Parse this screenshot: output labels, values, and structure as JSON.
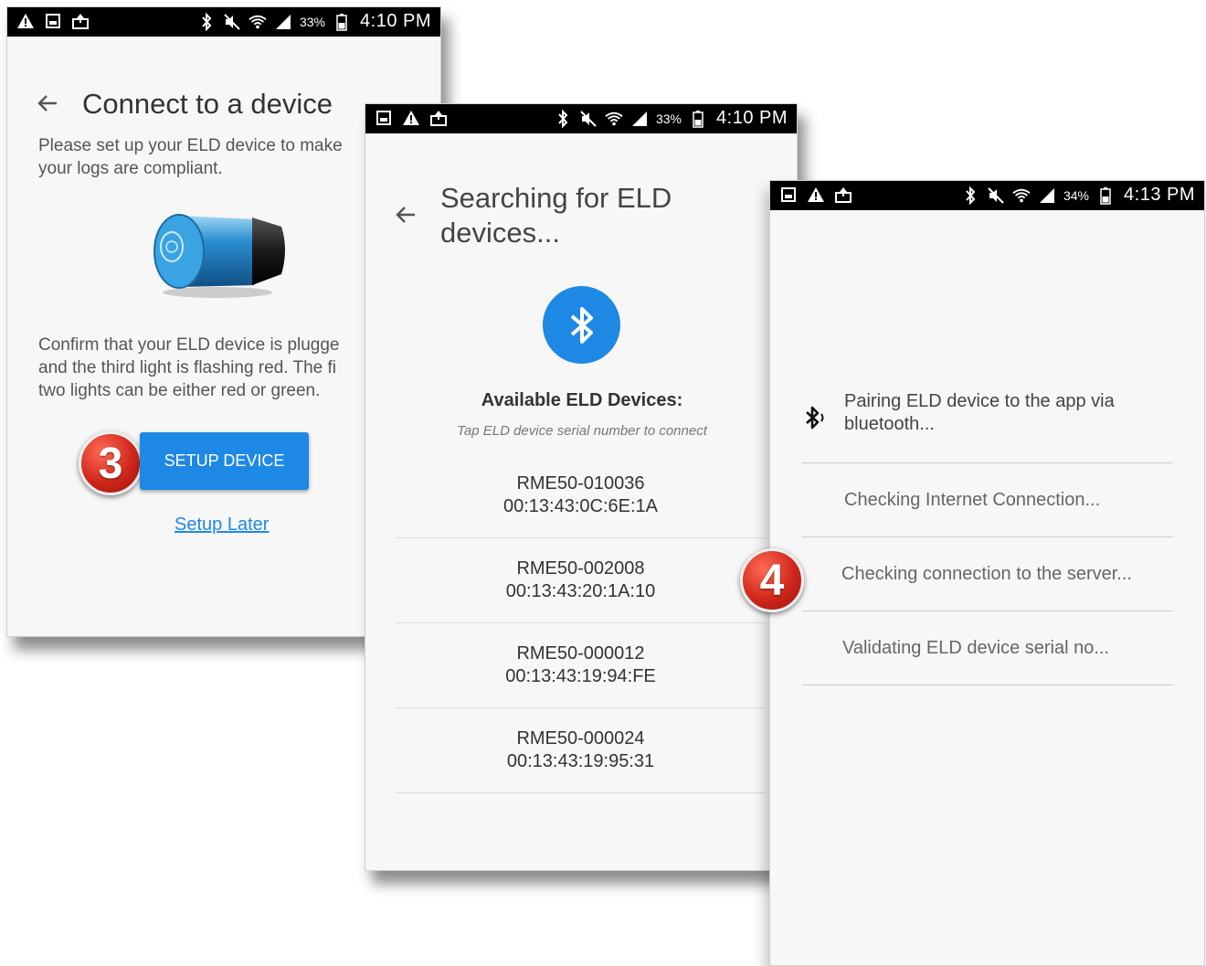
{
  "screen1": {
    "status": {
      "battery": "33%",
      "time": "4:10 PM"
    },
    "title": "Connect to a device",
    "intro": "Please set up your ELD device to make\nyour logs are compliant.",
    "confirm": "Confirm that your ELD device is plugge\nand the third light is flashing red. The fi\ntwo lights can be either red or green.",
    "badge": "3",
    "setup_button": "SETUP DEVICE",
    "setup_later": "Setup Later"
  },
  "screen2": {
    "status": {
      "battery": "33%",
      "time": "4:10 PM"
    },
    "title": "Searching for ELD\ndevices...",
    "available_title": "Available ELD Devices:",
    "available_subtitle": "Tap ELD device serial number to connect",
    "devices": [
      {
        "serial": "RME50-010036",
        "mac": "00:13:43:0C:6E:1A"
      },
      {
        "serial": "RME50-002008",
        "mac": "00:13:43:20:1A:10"
      },
      {
        "serial": "RME50-000012",
        "mac": "00:13:43:19:94:FE"
      },
      {
        "serial": "RME50-000024",
        "mac": "00:13:43:19:95:31"
      }
    ]
  },
  "screen3": {
    "status": {
      "battery": "34%",
      "time": "4:13 PM"
    },
    "badge": "4",
    "steps": [
      "Pairing ELD device to the app via\nbluetooth...",
      "Checking Internet Connection...",
      "Checking connection to the server...",
      "Validating ELD device serial no..."
    ]
  },
  "icons": {
    "status_left": [
      "warning-icon",
      "gallery-icon",
      "upload-icon"
    ],
    "status_right": [
      "bluetooth-icon",
      "mute-icon",
      "wifi-icon",
      "signal-icon",
      "battery-icon"
    ],
    "back": "back-arrow-icon",
    "bluetooth": "bluetooth-icon",
    "device": "eld-device-image"
  },
  "colors": {
    "accent": "#1e88e5",
    "badge": "#d0271b",
    "statusbar": "#000000"
  }
}
